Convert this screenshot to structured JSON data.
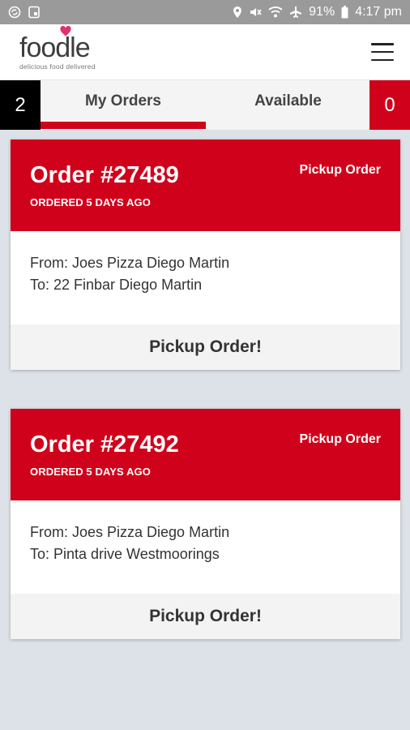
{
  "status_bar": {
    "battery": "91%",
    "time": "4:17 pm",
    "icons": [
      "sync-icon",
      "image-icon",
      "location-icon",
      "mute-icon",
      "wifi-icon",
      "airplane-icon",
      "battery-icon"
    ]
  },
  "header": {
    "logo_text": "foodle",
    "logo_tagline": "delicious food delivered",
    "menu_icon": "hamburger-menu-icon"
  },
  "tabs": {
    "my_orders_count": "2",
    "my_orders_label": "My Orders",
    "available_label": "Available",
    "available_count": "0",
    "active": "My Orders"
  },
  "orders": [
    {
      "title": "Order #27489",
      "time": "ORDERED 5 DAYS AGO",
      "type": "Pickup Order",
      "from": "From: Joes Pizza Diego Martin",
      "to": "To: 22 Finbar Diego Martin",
      "action": "Pickup Order!"
    },
    {
      "title": "Order #27492",
      "time": "ORDERED 5 DAYS AGO",
      "type": "Pickup Order",
      "from": "From: Joes Pizza Diego Martin",
      "to": "To: Pinta drive Westmoorings",
      "action": "Pickup Order!"
    }
  ],
  "colors": {
    "accent": "#d0021b",
    "status_bar": "#9a9a9a",
    "background": "#dde2e8"
  }
}
